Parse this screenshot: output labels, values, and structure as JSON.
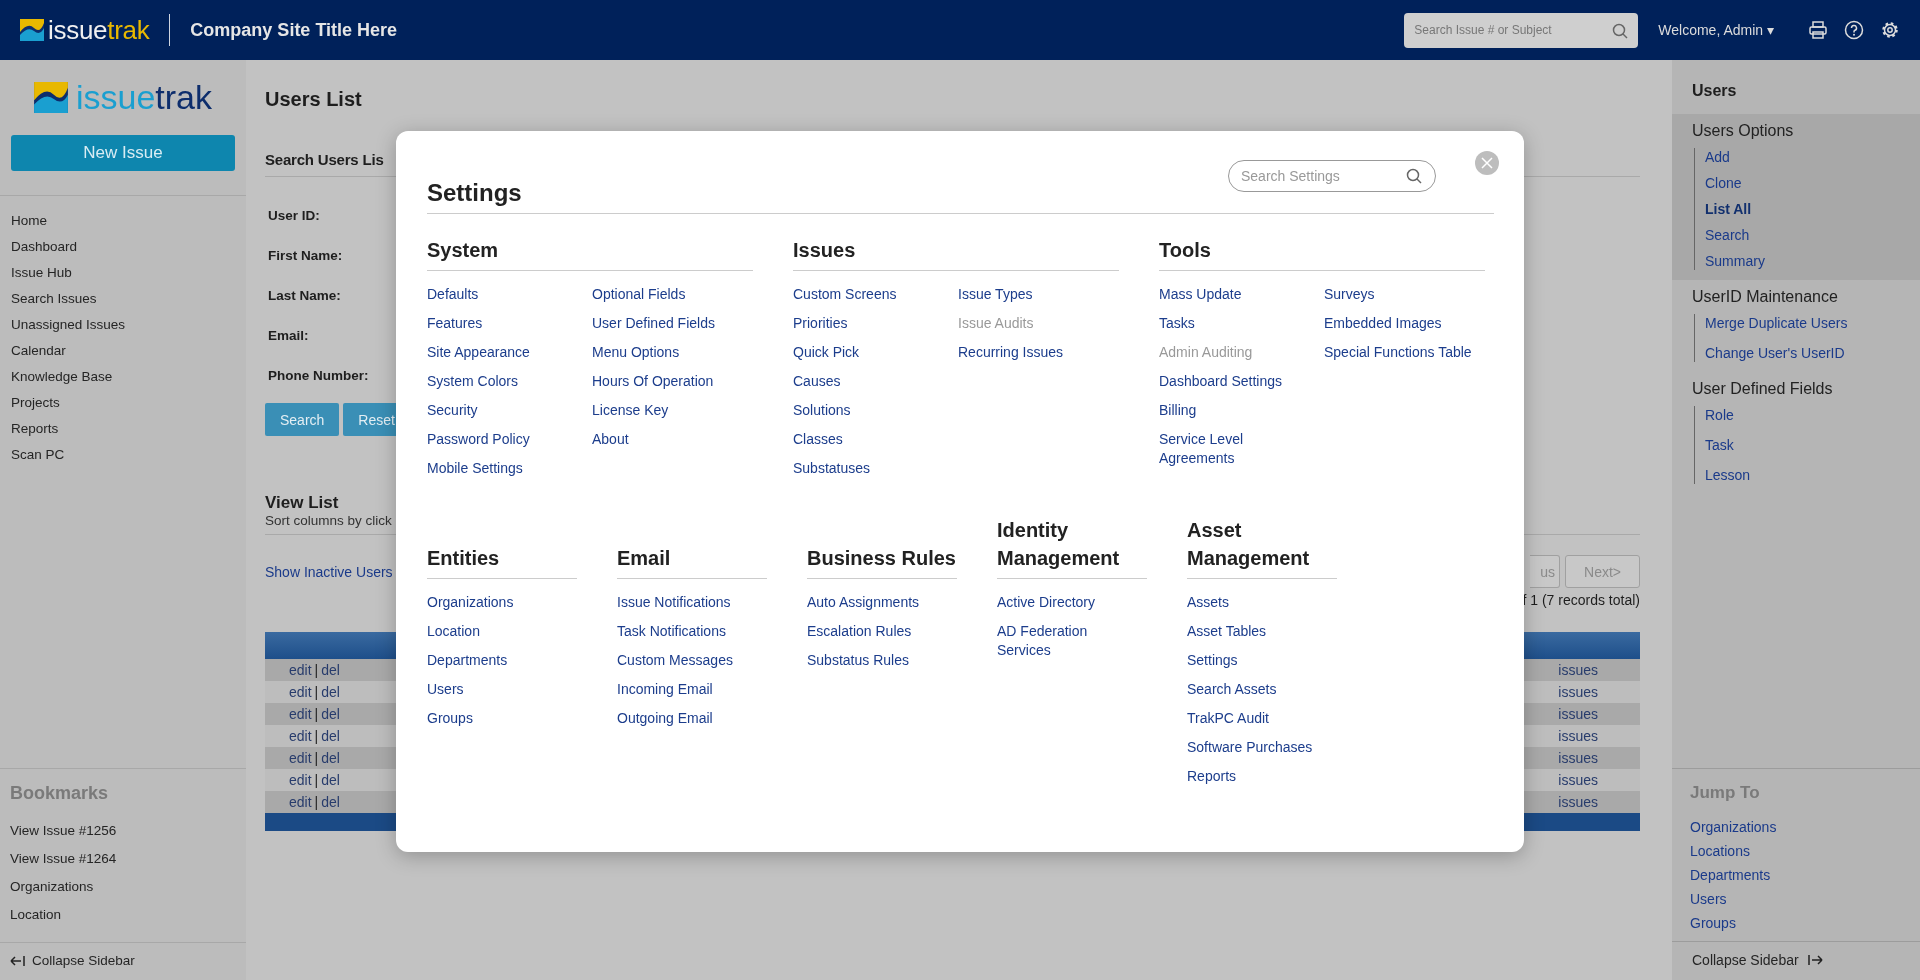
{
  "header": {
    "logo": [
      "issue",
      "trak"
    ],
    "site_title": "Company Site Title Here",
    "search": {
      "placeholder": "Search Issue # or Subject"
    },
    "welcome": "Welcome, Admin ▾"
  },
  "left_sidebar": {
    "logo": [
      "issue",
      "trak"
    ],
    "new_issue": "New Issue",
    "nav": [
      "Home",
      "Dashboard",
      "Issue Hub",
      "Search Issues",
      "Unassigned Issues",
      "Calendar",
      "Knowledge Base",
      "Projects",
      "Reports",
      "Scan PC"
    ],
    "bookmarks": {
      "title": "Bookmarks",
      "items": [
        "View Issue #1256",
        "View Issue #1264",
        "Organizations",
        "Location"
      ]
    },
    "collapse": "Collapse Sidebar"
  },
  "main": {
    "title": "Users List",
    "search_title": "Search Users Lis",
    "fields": [
      "User ID:",
      "First Name:",
      "Last Name:",
      "Email:",
      "Phone Number:"
    ],
    "buttons": [
      "Search",
      "Reset"
    ],
    "view_title": "View List",
    "view_hint": "Sort columns by click",
    "show_inactive": "Show Inactive Users",
    "pager": {
      "previous": {
        "label": "us",
        "disabled": true
      },
      "next": {
        "label": "Next>",
        "disabled": true
      },
      "summary": "f 1 (7 records total)"
    },
    "table": {
      "rows": [
        {
          "actions": [
            "edit",
            "del"
          ],
          "separator": "|",
          "link": "issues"
        },
        {
          "actions": [
            "edit",
            "del"
          ],
          "separator": "|",
          "link": "issues"
        },
        {
          "actions": [
            "edit",
            "del"
          ],
          "separator": "|",
          "link": "issues"
        },
        {
          "actions": [
            "edit",
            "del"
          ],
          "separator": "|",
          "link": "issues"
        },
        {
          "actions": [
            "edit",
            "del"
          ],
          "separator": "|",
          "link": "issues"
        },
        {
          "actions": [
            "edit",
            "del"
          ],
          "separator": "|",
          "link": "issues"
        },
        {
          "actions": [
            "edit",
            "del"
          ],
          "separator": "|",
          "link": "issues"
        }
      ]
    }
  },
  "right_sidebar": {
    "title": "Users",
    "groups": [
      {
        "title": "Users Options",
        "highlighted": true,
        "items": [
          {
            "label": "Add",
            "selected": false
          },
          {
            "label": "Clone",
            "selected": false
          },
          {
            "label": "List All",
            "selected": true
          },
          {
            "label": "Search",
            "selected": false
          },
          {
            "label": "Summary",
            "selected": false
          }
        ]
      },
      {
        "title": "UserID Maintenance",
        "highlighted": false,
        "items": [
          {
            "label": "Merge Duplicate Users",
            "selected": false
          },
          {
            "label": "Change User's UserID",
            "selected": false
          }
        ]
      },
      {
        "title": "User Defined Fields",
        "highlighted": false,
        "items": [
          {
            "label": "Role",
            "selected": false
          },
          {
            "label": "Task",
            "selected": false
          },
          {
            "label": "Lesson",
            "selected": false
          }
        ]
      }
    ],
    "jump_to": {
      "title": "Jump To",
      "items": [
        "Organizations",
        "Locations",
        "Departments",
        "Users",
        "Groups"
      ]
    },
    "collapse": "Collapse Sidebar"
  },
  "modal": {
    "title": "Settings",
    "search": {
      "placeholder": "Search Settings"
    },
    "sections": [
      {
        "title": "System",
        "columns": [
          [
            {
              "label": "Defaults",
              "disabled": false
            },
            {
              "label": "Features",
              "disabled": false
            },
            {
              "label": "Site Appearance",
              "disabled": false
            },
            {
              "label": "System Colors",
              "disabled": false
            },
            {
              "label": "Security",
              "disabled": false
            },
            {
              "label": "Password Policy",
              "disabled": false
            },
            {
              "label": "Mobile Settings",
              "disabled": false
            }
          ],
          [
            {
              "label": "Optional Fields",
              "disabled": false
            },
            {
              "label": "User Defined Fields",
              "disabled": false
            },
            {
              "label": "Menu Options",
              "disabled": false
            },
            {
              "label": "Hours Of Operation",
              "disabled": false
            },
            {
              "label": "License Key",
              "disabled": false
            },
            {
              "label": "About",
              "disabled": false
            }
          ]
        ]
      },
      {
        "title": "Issues",
        "columns": [
          [
            {
              "label": "Custom Screens",
              "disabled": false
            },
            {
              "label": "Priorities",
              "disabled": false
            },
            {
              "label": "Quick Pick",
              "disabled": false
            },
            {
              "label": "Causes",
              "disabled": false
            },
            {
              "label": "Solutions",
              "disabled": false
            },
            {
              "label": "Classes",
              "disabled": false
            },
            {
              "label": "Substatuses",
              "disabled": false
            }
          ],
          [
            {
              "label": "Issue Types",
              "disabled": false
            },
            {
              "label": "Issue Audits",
              "disabled": true
            },
            {
              "label": "Recurring Issues",
              "disabled": false
            }
          ]
        ]
      },
      {
        "title": "Tools",
        "columns": [
          [
            {
              "label": "Mass Update",
              "disabled": false
            },
            {
              "label": "Tasks",
              "disabled": false
            },
            {
              "label": "Admin Auditing",
              "disabled": true
            },
            {
              "label": "Dashboard Settings",
              "disabled": false
            },
            {
              "label": "Billing",
              "disabled": false
            },
            {
              "label": "Service Level Agreements",
              "disabled": false
            }
          ],
          [
            {
              "label": "Surveys",
              "disabled": false
            },
            {
              "label": "Embedded Images",
              "disabled": false
            },
            {
              "label": "Special Functions Table",
              "disabled": false
            }
          ]
        ]
      },
      {
        "title": "Entities",
        "columns": [
          [
            {
              "label": "Organizations",
              "disabled": false
            },
            {
              "label": "Location",
              "disabled": false
            },
            {
              "label": "Departments",
              "disabled": false
            },
            {
              "label": "Users",
              "disabled": false
            },
            {
              "label": "Groups",
              "disabled": false
            }
          ]
        ]
      },
      {
        "title": "Email",
        "columns": [
          [
            {
              "label": "Issue Notifications",
              "disabled": false
            },
            {
              "label": "Task Notifications",
              "disabled": false
            },
            {
              "label": "Custom Messages",
              "disabled": false
            },
            {
              "label": "Incoming Email",
              "disabled": false
            },
            {
              "label": "Outgoing Email",
              "disabled": false
            }
          ]
        ]
      },
      {
        "title": "Business Rules",
        "columns": [
          [
            {
              "label": "Auto Assignments",
              "disabled": false
            },
            {
              "label": "Escalation Rules",
              "disabled": false
            },
            {
              "label": "Substatus Rules",
              "disabled": false
            }
          ]
        ]
      },
      {
        "title": "Identity Management",
        "columns": [
          [
            {
              "label": "Active Directory",
              "disabled": false
            },
            {
              "label": "AD Federation Services",
              "disabled": false
            }
          ]
        ]
      },
      {
        "title": "Asset Management",
        "columns": [
          [
            {
              "label": "Assets",
              "disabled": false
            },
            {
              "label": "Asset Tables",
              "disabled": false
            },
            {
              "label": "Settings",
              "disabled": false
            },
            {
              "label": "Search Assets",
              "disabled": false
            },
            {
              "label": "TrakPC Audit",
              "disabled": false
            },
            {
              "label": "Software Purchases",
              "disabled": false
            },
            {
              "label": "Reports",
              "disabled": false
            }
          ]
        ]
      }
    ]
  }
}
